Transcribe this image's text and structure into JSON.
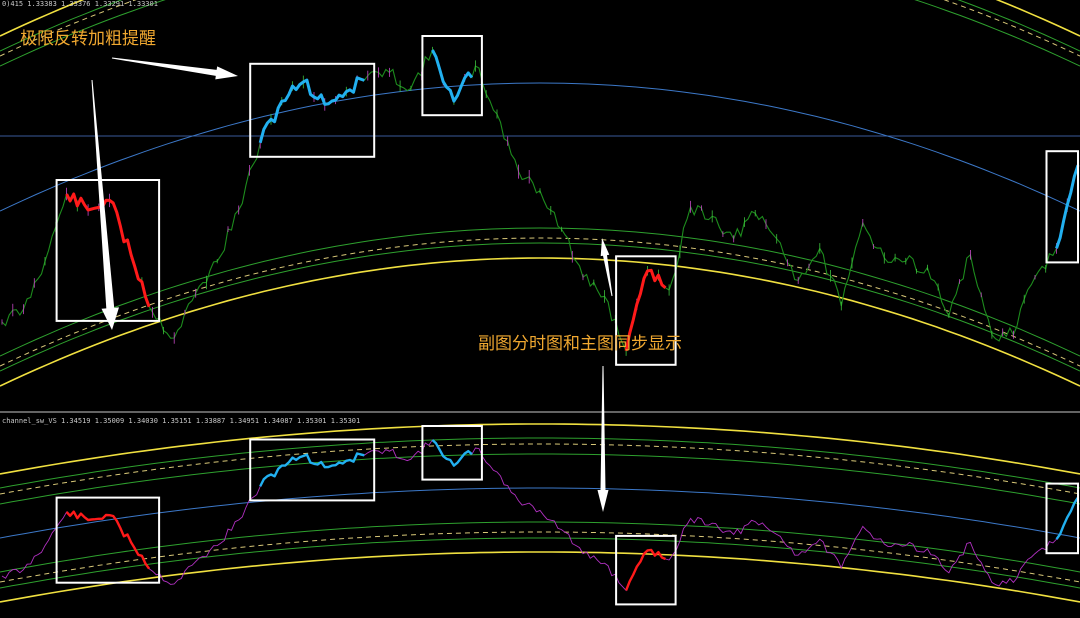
{
  "main_header": "0)415  1.33383 1.33376 1.33291 1.33301",
  "sub_header": "channel_sw_VS 1.34519 1.35009 1.34030 1.35151 1.33887 1.34951 1.34087 1.35301 1.35301",
  "annotations": {
    "reversal_label": "极限反转加粗提醒",
    "sync_label": "副图分时图和主图同步显示"
  },
  "colors": {
    "background": "#000000",
    "price_line": "#1d8c1d",
    "candle_bear": "#c648c6",
    "sub_line": "#b030c0",
    "outer_band": "#f0e040",
    "mid_band": "#2ea02e",
    "dashed_band": "#d8c878",
    "center_line": "#3c78c8",
    "bullish_extreme": "#22b0f0",
    "bearish_extreme": "#ff1a1a",
    "highlight_box": "#ffffff",
    "arrow": "#ffffff",
    "annotation_text": "#f0a830",
    "separator": "#c8c8c8",
    "crosshair": "#3a5a9a"
  },
  "chart_data": [
    {
      "type": "line",
      "panel": "main",
      "series": [
        {
          "values": [
            0.15,
            0.19,
            0.34,
            0.55,
            0.5,
            0.53,
            0.36,
            0.18,
            0.1,
            0.24,
            0.34,
            0.5,
            0.71,
            0.84,
            0.9,
            0.83,
            0.87,
            0.92,
            0.93,
            0.88,
            1.0,
            0.84,
            0.95,
            0.8,
            0.62,
            0.56,
            0.44,
            0.29,
            0.23,
            0.06,
            0.31,
            0.25,
            0.51,
            0.48,
            0.41,
            0.49,
            0.41,
            0.28,
            0.38,
            0.2,
            0.46,
            0.35,
            0.34,
            0.32,
            0.17,
            0.36,
            0.11,
            0.11,
            0.29,
            0.38,
            0.64
          ]
        }
      ],
      "bullish_extreme_segments": [
        [
          12,
          16
        ],
        [
          20,
          21
        ],
        [
          49,
          50
        ]
      ],
      "bearish_extreme_segments": [
        [
          3,
          6
        ],
        [
          29,
          30
        ]
      ]
    },
    {
      "type": "line",
      "panel": "sub",
      "series": [
        {
          "values": [
            0.15,
            0.19,
            0.34,
            0.55,
            0.5,
            0.53,
            0.36,
            0.18,
            0.1,
            0.24,
            0.34,
            0.5,
            0.71,
            0.84,
            0.9,
            0.83,
            0.87,
            0.92,
            0.93,
            0.88,
            1.0,
            0.84,
            0.95,
            0.8,
            0.62,
            0.56,
            0.44,
            0.29,
            0.23,
            0.06,
            0.31,
            0.25,
            0.51,
            0.48,
            0.41,
            0.49,
            0.41,
            0.28,
            0.38,
            0.2,
            0.46,
            0.35,
            0.34,
            0.32,
            0.17,
            0.36,
            0.11,
            0.11,
            0.29,
            0.38,
            0.64
          ]
        }
      ],
      "bullish_extreme_segments": [
        [
          12,
          16
        ],
        [
          20,
          21
        ],
        [
          49,
          50
        ]
      ],
      "bearish_extreme_segments": [
        [
          3,
          6
        ],
        [
          29,
          30
        ]
      ]
    }
  ]
}
